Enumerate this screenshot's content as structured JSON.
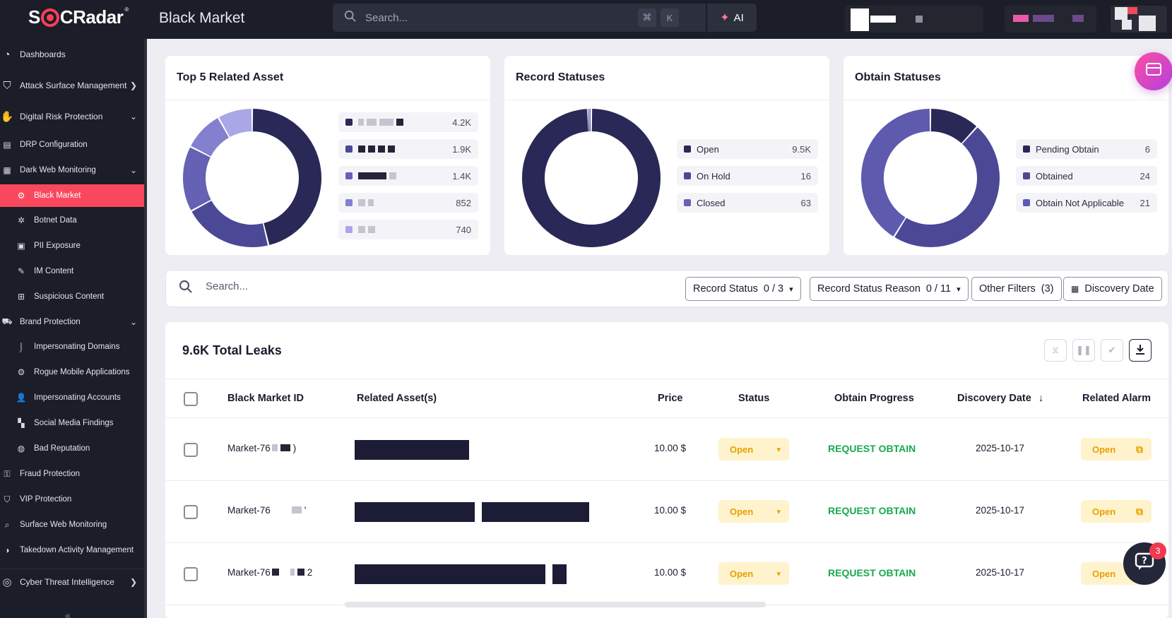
{
  "app": {
    "logo_text_a": "S",
    "logo_text_b": "CRadar",
    "logo_mark": "®",
    "page_title": "Black Market"
  },
  "global_search": {
    "placeholder": "Search...",
    "kbd_cmd": "⌘",
    "kbd_k": "K",
    "ai_label": "AI"
  },
  "sidebar": {
    "items": [
      {
        "label": "Dashboards",
        "icon": "dashboard-icon"
      },
      {
        "label": "Attack Surface Management",
        "icon": "shield-icon"
      },
      {
        "label": "Digital Risk Protection",
        "icon": "hand-icon"
      },
      {
        "label": "DRP Configuration",
        "icon": "config-icon"
      },
      {
        "label": "Dark Web Monitoring",
        "icon": "darkweb-icon"
      },
      {
        "label": "Black Market",
        "icon": "market-icon"
      },
      {
        "label": "Botnet Data",
        "icon": "bug-icon"
      },
      {
        "label": "PII Exposure",
        "icon": "id-card-icon"
      },
      {
        "label": "IM Content",
        "icon": "chat-icon"
      },
      {
        "label": "Suspicious Content",
        "icon": "warning-icon"
      },
      {
        "label": "Brand Protection",
        "icon": "brand-icon"
      },
      {
        "label": "Impersonating Domains",
        "icon": "hook-icon"
      },
      {
        "label": "Rogue Mobile Applications",
        "icon": "mobile-icon"
      },
      {
        "label": "Impersonating Accounts",
        "icon": "user-icon"
      },
      {
        "label": "Social Media Findings",
        "icon": "grid-icon"
      },
      {
        "label": "Bad Reputation",
        "icon": "globe-icon"
      },
      {
        "label": "Fraud Protection",
        "icon": "fraud-icon"
      },
      {
        "label": "VIP Protection",
        "icon": "vip-icon"
      },
      {
        "label": "Surface Web Monitoring",
        "icon": "web-icon"
      },
      {
        "label": "Takedown Activity Management",
        "icon": "takedown-icon"
      },
      {
        "label": "Cyber Threat Intelligence",
        "icon": "cti-icon"
      }
    ],
    "collapse_glyph": "«"
  },
  "cards": {
    "top_assets": {
      "title": "Top 5 Related Asset",
      "values": [
        "4.2K",
        "1.9K",
        "1.4K",
        "852",
        "740"
      ],
      "numbers": [
        4200,
        1900,
        1400,
        852,
        740
      ],
      "colors": [
        "#2a2856",
        "#4b4896",
        "#6561b5",
        "#8480cf",
        "#aaa7e6"
      ]
    },
    "record_statuses": {
      "title": "Record Statuses",
      "items": [
        {
          "label": "Open",
          "value": "9.5K",
          "number": 9500,
          "color": "#2a2856"
        },
        {
          "label": "On Hold",
          "value": "16",
          "number": 16,
          "color": "#4b4896"
        },
        {
          "label": "Closed",
          "value": "63",
          "number": 63,
          "color": "#6561b5"
        }
      ]
    },
    "obtain_statuses": {
      "title": "Obtain Statuses",
      "items": [
        {
          "label": "Pending Obtain",
          "value": "6",
          "number": 6,
          "color": "#2a2856"
        },
        {
          "label": "Obtained",
          "value": "24",
          "number": 24,
          "color": "#4b4896"
        },
        {
          "label": "Obtain Not Applicable",
          "value": "21",
          "number": 21,
          "color": "#5e5aae"
        }
      ]
    }
  },
  "filters": {
    "search_placeholder": "Search...",
    "record_status": {
      "label": "Record Status",
      "count": "0 / 3"
    },
    "record_status_reason": {
      "label": "Record Status Reason",
      "count": "0 / 11"
    },
    "other_filters": {
      "label": "Other Filters",
      "count": "(3)"
    },
    "discovery_date": {
      "label": "Discovery Date"
    }
  },
  "table": {
    "total_title": "9.6K Total Leaks",
    "columns": [
      "Black Market ID",
      "Related Asset(s)",
      "Price",
      "Status",
      "Obtain Progress",
      "Discovery Date",
      "Related Alarm"
    ],
    "sort_glyph": "↓",
    "rows": [
      {
        "id": "Market-76",
        "id_tail": ")",
        "price": "10.00 $",
        "status": "Open",
        "progress": "REQUEST OBTAIN",
        "date": "2025-10-17",
        "alarm": "Open"
      },
      {
        "id": "Market-76",
        "id_tail": "'",
        "price": "10.00 $",
        "status": "Open",
        "progress": "REQUEST OBTAIN",
        "date": "2025-10-17",
        "alarm": "Open"
      },
      {
        "id": "Market-76",
        "id_tail": "2",
        "price": "10.00 $",
        "status": "Open",
        "progress": "REQUEST OBTAIN",
        "date": "2025-10-17",
        "alarm": "Open"
      }
    ]
  },
  "chat_badge": "3",
  "colors": {
    "accent": "#f9485d",
    "sidebar_bg": "#1b1d28",
    "status_open": "#e8a000",
    "request_obtain": "#18a94f"
  }
}
